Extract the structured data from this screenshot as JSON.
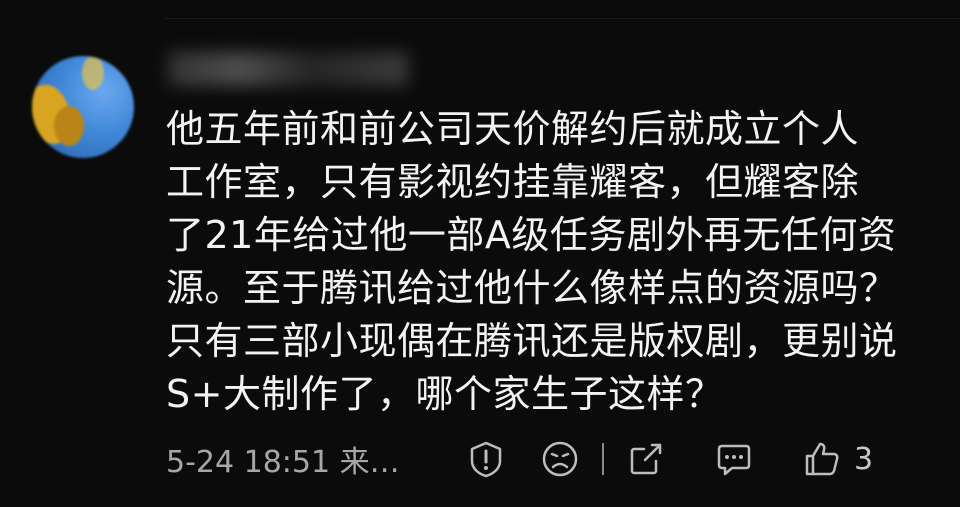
{
  "comment": {
    "text": "他五年前和前公司天价解约后就成立个人\n工作室，只有影视约挂靠耀客，但耀客除\n了21年给过他一部A级任务剧外再无任何资\n源。至于腾讯给过他什么像样点的资源吗？\n只有三部小现偶在腾讯还是版权剧，更别说\nS+大制作了，哪个家生子这样？",
    "meta": "5-24 18:51 来…",
    "like_count": "3"
  },
  "icons": [
    "warning-icon",
    "dislike-face-icon",
    "share-icon",
    "reply-icon",
    "thumbs-up-icon"
  ],
  "colors": {
    "background": "#0b0b0b",
    "text": "#f3f3f3",
    "meta": "#a7a7a7",
    "icon": "#bdbdbd"
  }
}
